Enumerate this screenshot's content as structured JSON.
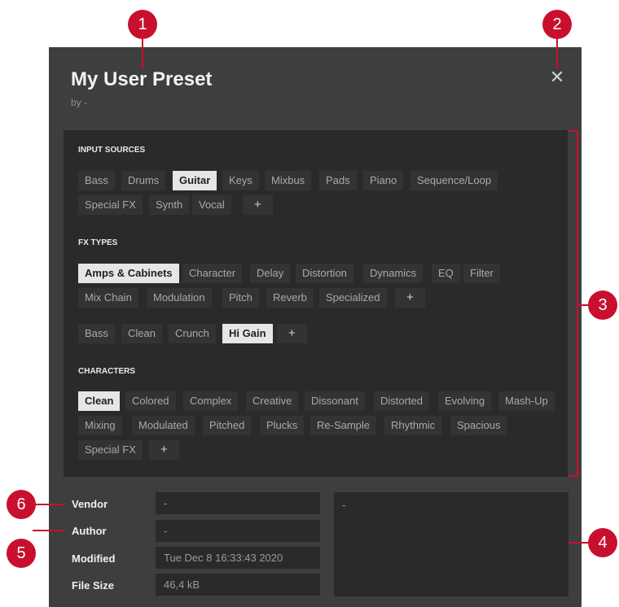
{
  "dialog": {
    "title": "My User Preset",
    "subtitle": "by -",
    "close_glyph": "✕"
  },
  "sections": {
    "input_sources": "INPUT SOURCES",
    "fx_types": "FX TYPES",
    "characters": "CHARACTERS"
  },
  "tags": {
    "input_sources": [
      {
        "label": "Bass",
        "active": false
      },
      {
        "label": "Drums",
        "active": false
      },
      {
        "label": "Guitar",
        "active": true
      },
      {
        "label": "Keys",
        "active": false
      },
      {
        "label": "Mixbus",
        "active": false
      },
      {
        "label": "Pads",
        "active": false
      },
      {
        "label": "Piano",
        "active": false
      },
      {
        "label": "Sequence/Loop",
        "active": false
      },
      {
        "label": "Special FX",
        "active": false
      },
      {
        "label": "Synth",
        "active": false
      },
      {
        "label": "Vocal",
        "active": false
      },
      {
        "label": "+",
        "active": false
      }
    ],
    "fx_types": [
      {
        "label": "Amps & Cabinets",
        "active": true
      },
      {
        "label": "Character",
        "active": false
      },
      {
        "label": "Delay",
        "active": false
      },
      {
        "label": "Distortion",
        "active": false
      },
      {
        "label": "Dynamics",
        "active": false
      },
      {
        "label": "EQ",
        "active": false
      },
      {
        "label": "Filter",
        "active": false
      },
      {
        "label": "Mix Chain",
        "active": false
      },
      {
        "label": "Modulation",
        "active": false
      },
      {
        "label": "Pitch",
        "active": false
      },
      {
        "label": "Reverb",
        "active": false
      },
      {
        "label": "Specialized",
        "active": false
      },
      {
        "label": "+",
        "active": false
      }
    ],
    "fx_subtypes": [
      {
        "label": "Bass",
        "active": false
      },
      {
        "label": "Clean",
        "active": false
      },
      {
        "label": "Crunch",
        "active": false
      },
      {
        "label": "Hi Gain",
        "active": true
      },
      {
        "label": "+",
        "active": false
      }
    ],
    "characters": [
      {
        "label": "Clean",
        "active": true
      },
      {
        "label": "Colored",
        "active": false
      },
      {
        "label": "Complex",
        "active": false
      },
      {
        "label": "Creative",
        "active": false
      },
      {
        "label": "Dissonant",
        "active": false
      },
      {
        "label": "Distorted",
        "active": false
      },
      {
        "label": "Evolving",
        "active": false
      },
      {
        "label": "Mash-Up",
        "active": false
      },
      {
        "label": "Mixing",
        "active": false
      },
      {
        "label": "Modulated",
        "active": false
      },
      {
        "label": "Pitched",
        "active": false
      },
      {
        "label": "Plucks",
        "active": false
      },
      {
        "label": "Re-Sample",
        "active": false
      },
      {
        "label": "Rhythmic",
        "active": false
      },
      {
        "label": "Spacious",
        "active": false
      },
      {
        "label": "Special FX",
        "active": false
      },
      {
        "label": "+",
        "active": false
      }
    ]
  },
  "metadata": {
    "vendor_label": "Vendor",
    "vendor_value": "-",
    "author_label": "Author",
    "author_value": "-",
    "modified_label": "Modified",
    "modified_value": "Tue Dec 8 16:33:43 2020",
    "filesize_label": "File Size",
    "filesize_value": "46,4 kB",
    "comment_value": "-"
  },
  "callouts": [
    "1",
    "2",
    "3",
    "4",
    "5",
    "6"
  ],
  "colors": {
    "callout": "#c8102e",
    "panel": "#3e3e3e",
    "tagbox": "#2a2a2a",
    "tag_active": "#e6e6e6"
  }
}
